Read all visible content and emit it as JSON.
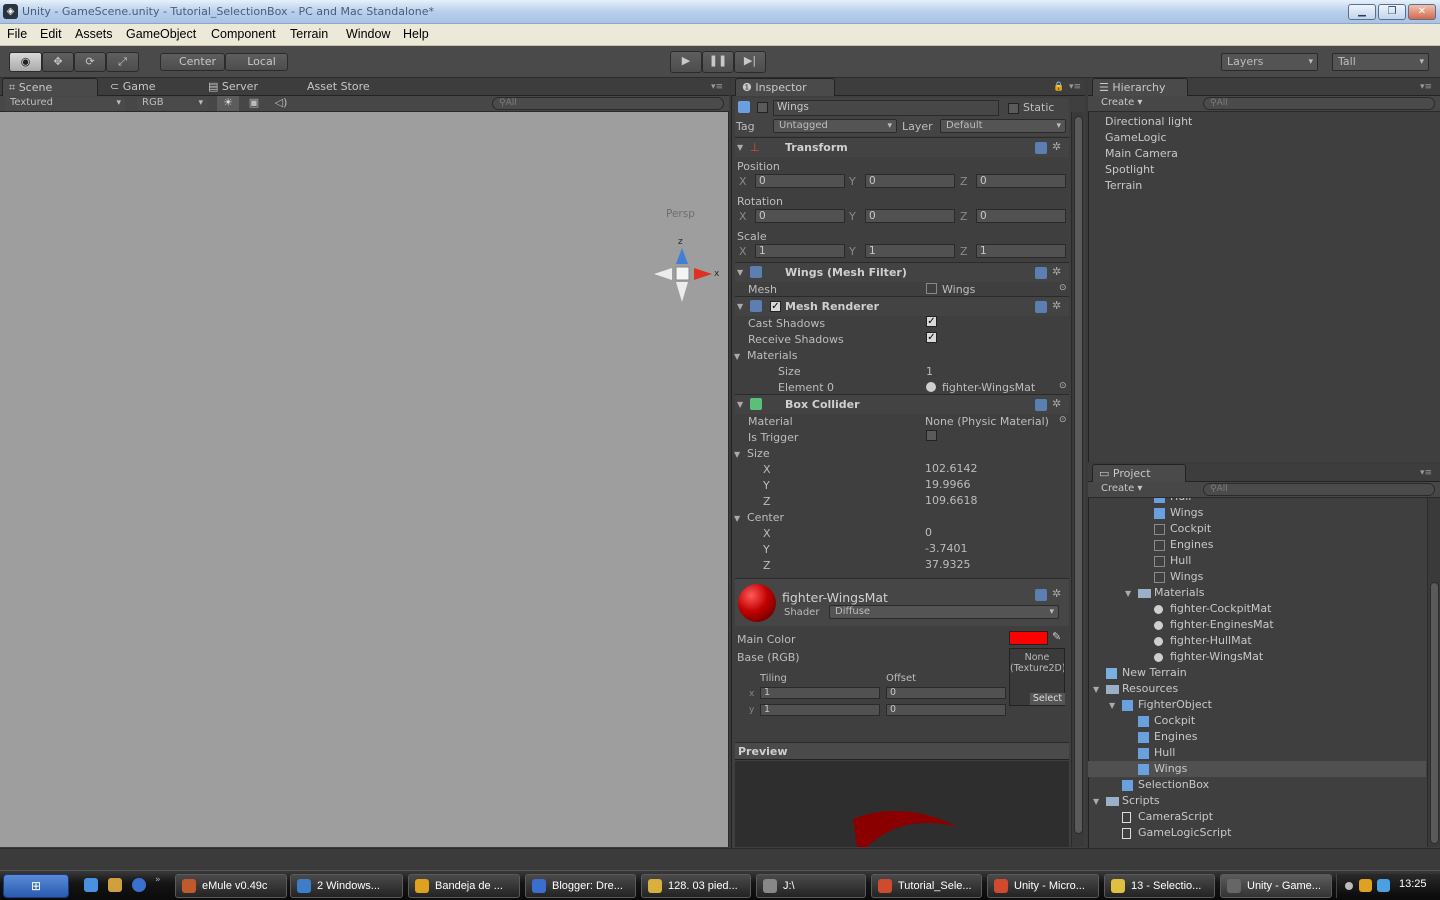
{
  "window": {
    "title": "Unity - GameScene.unity - Tutorial_SelectionBox - PC and Mac Standalone*",
    "min": "▁",
    "max": "❐",
    "close": "✕"
  },
  "menu": [
    "File",
    "Edit",
    "Assets",
    "GameObject",
    "Component",
    "Terrain",
    "Window",
    "Help"
  ],
  "toolbar": {
    "center": "Center",
    "local": "Local",
    "layers": "Layers",
    "layout": "Tall"
  },
  "scene": {
    "tabs": [
      "Scene",
      "Game",
      "Server",
      "Asset Store"
    ],
    "render_mode": "Textured",
    "color_mode": "RGB",
    "search": "All",
    "persp": "Persp",
    "axis_y": "z",
    "axis_x": "x"
  },
  "inspector": {
    "tab": "Inspector",
    "object_name": "Wings",
    "static_label": "Static",
    "tag_label": "Tag",
    "tag_value": "Untagged",
    "layer_label": "Layer",
    "layer_value": "Default",
    "transform": {
      "title": "Transform",
      "position_label": "Position",
      "rotation_label": "Rotation",
      "scale_label": "Scale",
      "position": {
        "x": "0",
        "y": "0",
        "z": "0"
      },
      "rotation": {
        "x": "0",
        "y": "0",
        "z": "0"
      },
      "scale": {
        "x": "1",
        "y": "1",
        "z": "1"
      }
    },
    "axis": {
      "x": "X",
      "y": "Y",
      "z": "Z"
    },
    "mesh_filter": {
      "title": "Wings (Mesh Filter)",
      "mesh_label": "Mesh",
      "mesh_value": "Wings"
    },
    "mesh_renderer": {
      "title": "Mesh Renderer",
      "cast_shadows": "Cast Shadows",
      "receive_shadows": "Receive Shadows",
      "materials": "Materials",
      "size_label": "Size",
      "size_value": "1",
      "element_label": "Element 0",
      "element_value": "fighter-WingsMat"
    },
    "box_collider": {
      "title": "Box Collider",
      "material_label": "Material",
      "material_value": "None (Physic Material)",
      "is_trigger": "Is Trigger",
      "size_label": "Size",
      "center_label": "Center",
      "size": {
        "x": "102.6142",
        "y": "19.9966",
        "z": "109.6618"
      },
      "center": {
        "x": "0",
        "y": "-3.7401",
        "z": "37.9325"
      },
      "lx": "X",
      "ly": "Y",
      "lz": "Z"
    },
    "material": {
      "name": "fighter-WingsMat",
      "shader_label": "Shader",
      "shader_value": "Diffuse",
      "main_color": "Main Color",
      "base": "Base (RGB)",
      "none_texture": "None (Texture2D)",
      "select": "Select",
      "tiling": "Tiling",
      "offset": "Offset",
      "tx": "1",
      "ty": "1",
      "ox": "0",
      "oy": "0",
      "lx": "x",
      "ly": "y"
    },
    "preview": "Preview"
  },
  "hierarchy": {
    "tab": "Hierarchy",
    "create": "Create",
    "search": "All",
    "items": [
      "Directional light",
      "GameLogic",
      "Main Camera",
      "Spotlight",
      "Terrain"
    ]
  },
  "project": {
    "tab": "Project",
    "create": "Create",
    "search": "All",
    "items": [
      {
        "label": "Hull",
        "indent": 4,
        "icon": "prefab"
      },
      {
        "label": "Wings",
        "indent": 4,
        "icon": "prefab"
      },
      {
        "label": "Cockpit",
        "indent": 4,
        "icon": "mesh"
      },
      {
        "label": "Engines",
        "indent": 4,
        "icon": "mesh"
      },
      {
        "label": "Hull",
        "indent": 4,
        "icon": "mesh"
      },
      {
        "label": "Wings",
        "indent": 4,
        "icon": "mesh"
      },
      {
        "label": "Materials",
        "indent": 3,
        "icon": "folder",
        "open": true
      },
      {
        "label": "fighter-CockpitMat",
        "indent": 4,
        "icon": "material"
      },
      {
        "label": "fighter-EnginesMat",
        "indent": 4,
        "icon": "material"
      },
      {
        "label": "fighter-HullMat",
        "indent": 4,
        "icon": "material"
      },
      {
        "label": "fighter-WingsMat",
        "indent": 4,
        "icon": "material"
      },
      {
        "label": "New Terrain",
        "indent": 1,
        "icon": "terrain"
      },
      {
        "label": "Resources",
        "indent": 1,
        "icon": "folder",
        "open": true
      },
      {
        "label": "FighterObject",
        "indent": 2,
        "icon": "prefab",
        "open": true
      },
      {
        "label": "Cockpit",
        "indent": 3,
        "icon": "prefab"
      },
      {
        "label": "Engines",
        "indent": 3,
        "icon": "prefab"
      },
      {
        "label": "Hull",
        "indent": 3,
        "icon": "prefab"
      },
      {
        "label": "Wings",
        "indent": 3,
        "icon": "prefab",
        "selected": true
      },
      {
        "label": "SelectionBox",
        "indent": 2,
        "icon": "prefab"
      },
      {
        "label": "Scripts",
        "indent": 1,
        "icon": "folder",
        "open": true
      },
      {
        "label": "CameraScript",
        "indent": 2,
        "icon": "script"
      },
      {
        "label": "GameLogicScript",
        "indent": 2,
        "icon": "script"
      }
    ]
  },
  "taskbar": {
    "tasks": [
      {
        "label": "eMule v0.49c",
        "color": "#c05a2a"
      },
      {
        "label": "2 Windows...",
        "color": "#3c7fc8"
      },
      {
        "label": "Bandeja de ...",
        "color": "#e0a020"
      },
      {
        "label": "Blogger: Dre...",
        "color": "#3a6fd0"
      },
      {
        "label": "128. 03 pied...",
        "color": "#d8b040"
      },
      {
        "label": "J:\\",
        "color": "#888888"
      },
      {
        "label": "Tutorial_Sele...",
        "color": "#d04a30"
      },
      {
        "label": "Unity - Micro...",
        "color": "#d04a30"
      },
      {
        "label": "13 - Selectio...",
        "color": "#e0c040"
      },
      {
        "label": "Unity - Game...",
        "color": "#666666",
        "active": true
      }
    ],
    "clock": "13:25"
  },
  "colors": {
    "main_color": "#ff0000",
    "material_sphere": "#c00000",
    "unity_dark": "#3b3b3b"
  }
}
